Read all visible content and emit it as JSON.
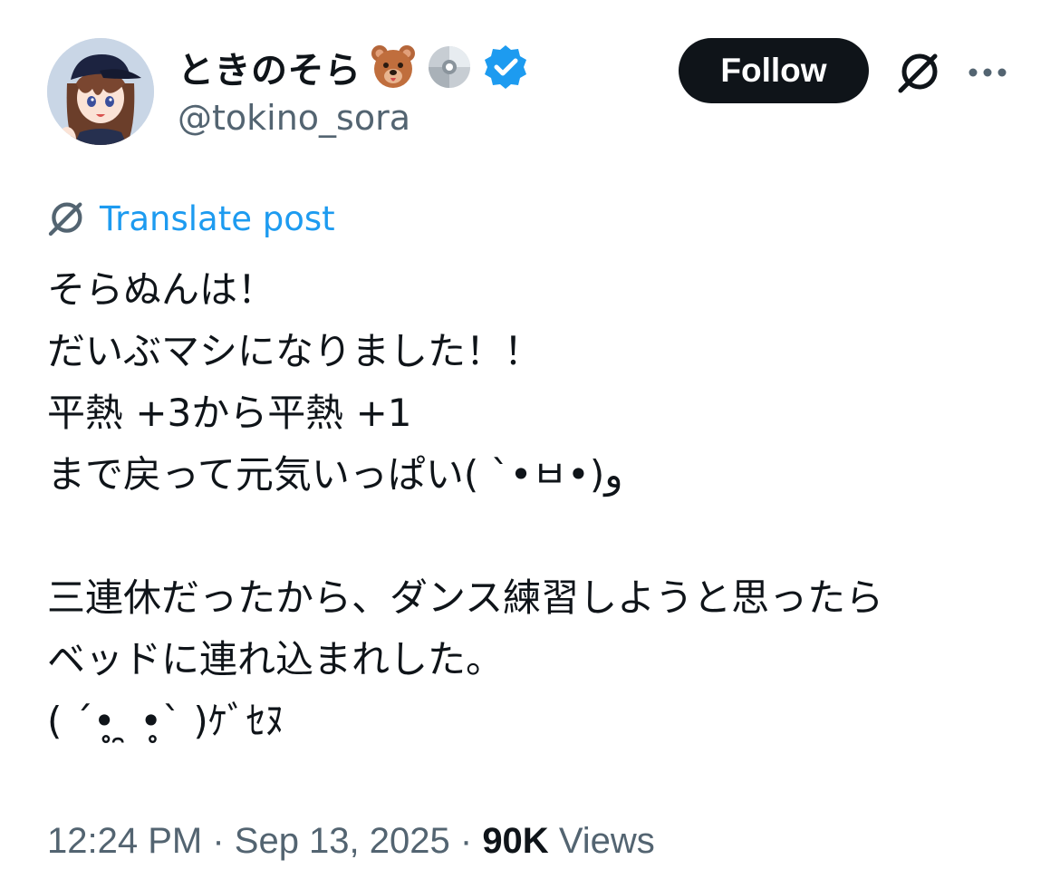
{
  "author": {
    "display_name": "ときのそら",
    "name_emojis": [
      "bear-face-emoji",
      "dvd-emoji"
    ],
    "verified_badge": "verified-badge-icon",
    "handle": "@tokino_sora",
    "avatar": "avatar-anime-girl-cap"
  },
  "actions": {
    "follow_label": "Follow",
    "grok_icon": "grok-icon",
    "more_icon": "more-icon"
  },
  "translate": {
    "icon": "grok-icon",
    "label": "Translate post"
  },
  "post": {
    "lines": [
      "そらぬんは！",
      "だいぶマシになりました！！",
      "平熱 +3から平熱 +1",
      "まで戻って元気いっぱい( ˋ•ㅂ•)و",
      "",
      "三連休だったから、ダンス練習しようと思ったら",
      "ベッドに連れ込まれした。",
      "( ˊ•̥ ̯ •̥ˋ )ｹﾞｾﾇ"
    ]
  },
  "meta": {
    "time": "12:24 PM",
    "sep1": " · ",
    "date": "Sep 13, 2025",
    "sep2": " · ",
    "views_count": "90K",
    "views_label": " Views"
  },
  "colors": {
    "text": "#0f1419",
    "secondary": "#536471",
    "link": "#1d9bf0",
    "follow_bg": "#0f1419",
    "verified": "#1d9bf0"
  }
}
